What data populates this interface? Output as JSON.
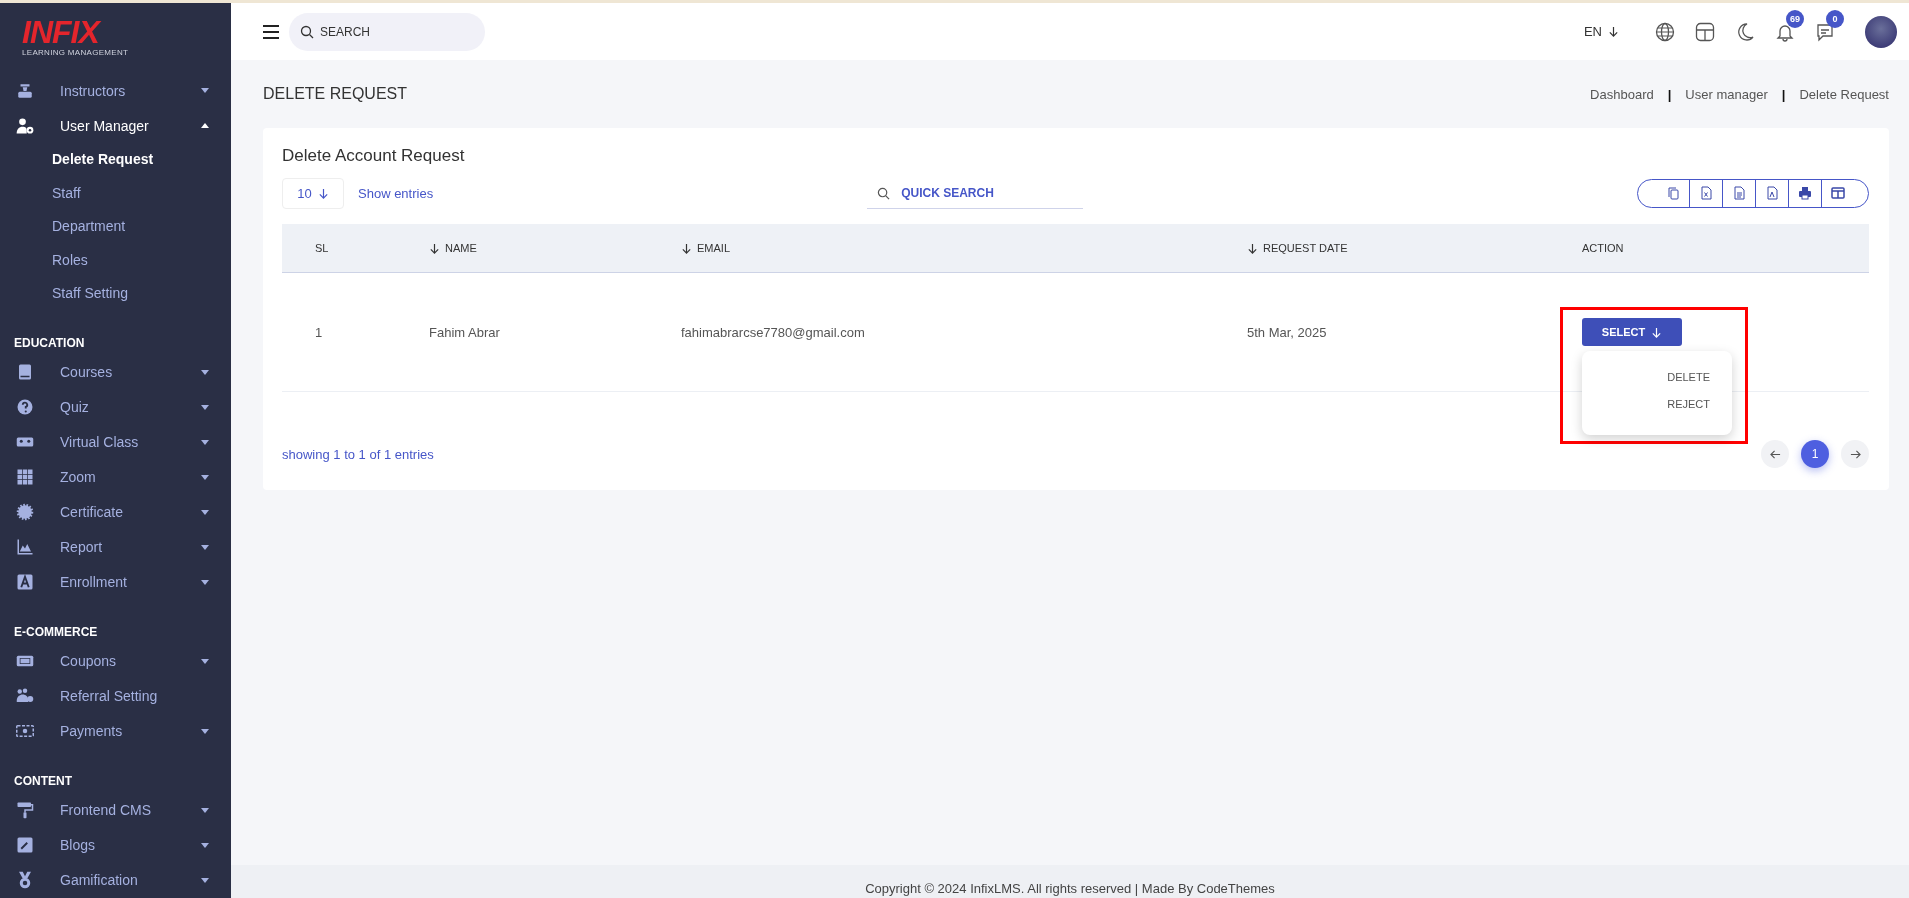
{
  "logo": {
    "mark": "INFIX",
    "tagline": "LEARNING MANAGEMENT"
  },
  "sidebar": {
    "sections": [
      {
        "items": [
          {
            "label": "Instructors",
            "kind": "group",
            "expanded": false
          },
          {
            "label": "User Manager",
            "kind": "group",
            "expanded": true,
            "children": [
              {
                "label": "Delete Request",
                "selected": true
              },
              {
                "label": "Staff",
                "selected": false
              },
              {
                "label": "Department",
                "selected": false
              },
              {
                "label": "Roles",
                "selected": false
              },
              {
                "label": "Staff Setting",
                "selected": false
              }
            ]
          }
        ]
      },
      {
        "title": "EDUCATION",
        "items": [
          {
            "label": "Courses",
            "kind": "group",
            "expanded": false
          },
          {
            "label": "Quiz",
            "kind": "group",
            "expanded": false
          },
          {
            "label": "Virtual Class",
            "kind": "group",
            "expanded": false
          },
          {
            "label": "Zoom",
            "kind": "group",
            "expanded": false
          },
          {
            "label": "Certificate",
            "kind": "group",
            "expanded": false
          },
          {
            "label": "Report",
            "kind": "group",
            "expanded": false
          },
          {
            "label": "Enrollment",
            "kind": "group",
            "expanded": false
          }
        ]
      },
      {
        "title": "E-COMMERCE",
        "items": [
          {
            "label": "Coupons",
            "kind": "group",
            "expanded": false
          },
          {
            "label": "Referral Setting",
            "kind": "link"
          },
          {
            "label": "Payments",
            "kind": "group",
            "expanded": false
          }
        ]
      },
      {
        "title": "CONTENT",
        "items": [
          {
            "label": "Frontend CMS",
            "kind": "group",
            "expanded": false
          },
          {
            "label": "Blogs",
            "kind": "group",
            "expanded": false
          },
          {
            "label": "Gamification",
            "kind": "group",
            "expanded": false
          }
        ]
      }
    ]
  },
  "topbar": {
    "search": {
      "placeholder": "SEARCH"
    },
    "language": "EN",
    "notifications": "69",
    "messages": "0"
  },
  "page": {
    "title": "DELETE REQUEST",
    "breadcrumbs": [
      {
        "kind": "link",
        "text": "Dashboard"
      },
      {
        "kind": "separator",
        "text": "|"
      },
      {
        "kind": "link",
        "text": "User manager"
      },
      {
        "kind": "separator",
        "text": "|"
      },
      {
        "kind": "link",
        "text": "Delete Request"
      }
    ]
  },
  "card": {
    "title": "Delete Account Request",
    "page_size": "10",
    "show_entries": "Show entries",
    "quick_search": {
      "placeholder": "QUICK SEARCH"
    },
    "table": {
      "columns": [
        {
          "label": "SL",
          "sortable": false
        },
        {
          "label": "NAME",
          "sortable": true
        },
        {
          "label": "EMAIL",
          "sortable": true
        },
        {
          "label": "REQUEST DATE",
          "sortable": true
        },
        {
          "label": "ACTION",
          "sortable": false
        }
      ],
      "rows": [
        {
          "sl": "1",
          "name": "Fahim Abrar",
          "email": "fahimabrarcse7780@gmail.com",
          "request_date": "5th Mar, 2025",
          "action": {
            "label": "SELECT",
            "open": true,
            "highlighted": true,
            "menu": [
              "DELETE",
              "REJECT"
            ]
          }
        }
      ]
    },
    "summary": "showing 1 to 1 of 1 entries",
    "pagination": {
      "pages": [
        {
          "label": "1",
          "selected": true
        }
      ]
    }
  },
  "footer": "Copyright © 2024 InfixLMS. All rights reserved | Made By CodeThemes"
}
